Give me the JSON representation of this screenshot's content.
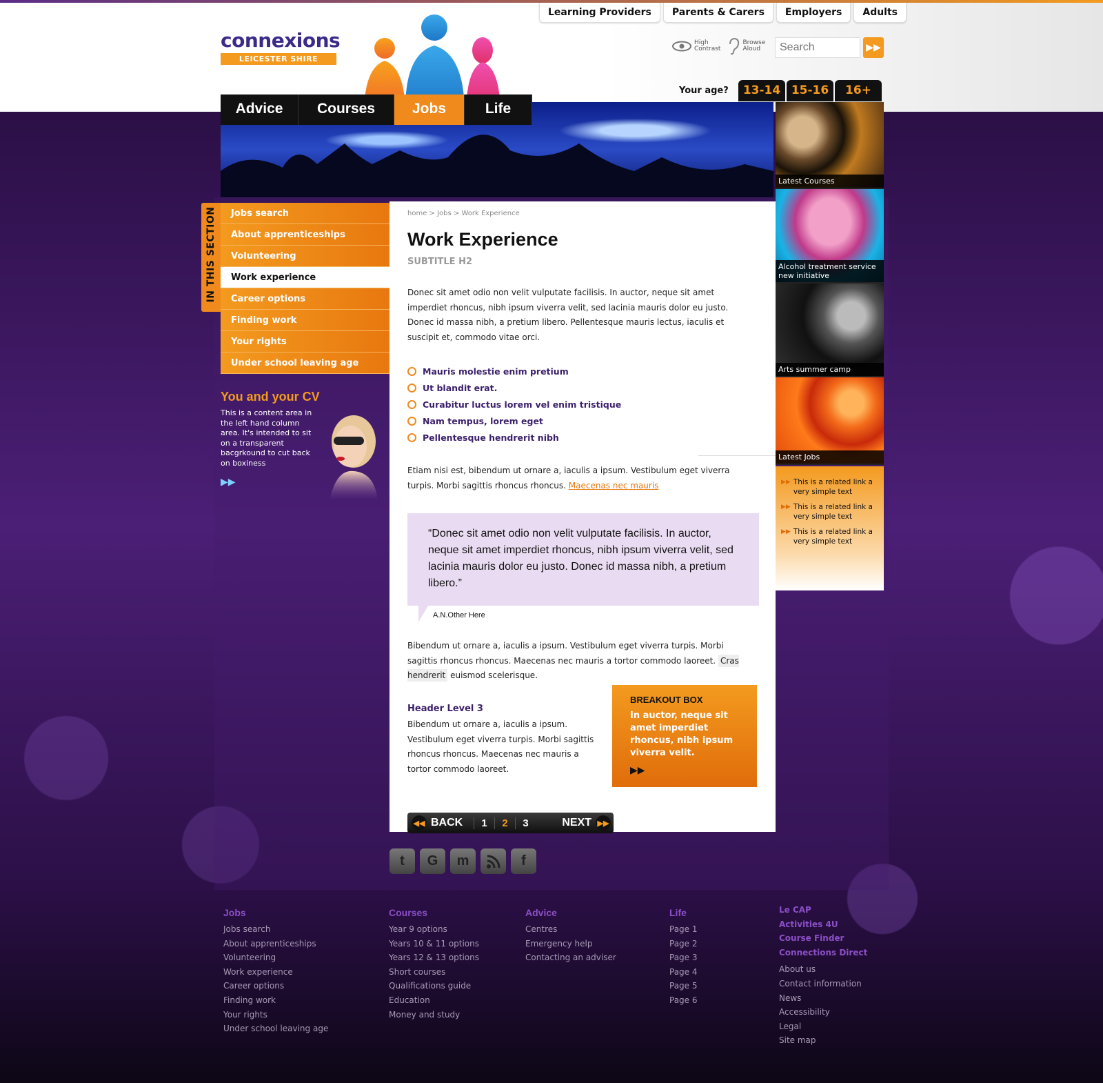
{
  "brand": {
    "logo_text": "connexions",
    "logo_sub": "LEICESTER SHIRE",
    "accent": "#f39a1f",
    "purple": "#3b1f6b"
  },
  "audience_tabs": [
    "Learning Providers",
    "Parents & Carers",
    "Employers",
    "Adults"
  ],
  "tools": {
    "contrast_l1": "High",
    "contrast_l2": "Contrast",
    "aloud_l1": "Browse",
    "aloud_l2": "Aloud"
  },
  "search": {
    "placeholder": "Search",
    "button_icon": "double-arrow-right-icon"
  },
  "age": {
    "label": "Your age?",
    "tabs": [
      "13-14",
      "15-16",
      "16+"
    ]
  },
  "main_nav": [
    "Advice",
    "Courses",
    "Jobs",
    "Life"
  ],
  "main_nav_active": "Jobs",
  "sidebar": {
    "section_label": "IN THIS SECTION",
    "items": [
      "Jobs search",
      "About apprenticeships",
      "Volunteering",
      "Work experience",
      "Career options",
      "Finding work",
      "Your rights",
      "Under school leaving age"
    ],
    "active": "Work experience"
  },
  "cv_promo": {
    "title": "You and your CV",
    "text": "This is a content area in the left hand column area.  It's intended to sit on a transparent bacgrkound to cut back on boxiness",
    "more_icon": "double-arrow-right-icon"
  },
  "content": {
    "breadcrumb": "home > Jobs > Work Experience",
    "title": "Work Experience",
    "subtitle": "SUBTITLE H2",
    "intro": "Donec sit amet odio non velit vulputate facilisis. In auctor, neque sit amet imperdiet rhoncus, nibh ipsum viverra velit, sed lacinia mauris dolor eu justo. Donec id massa nibh, a pretium libero. Pellentesque mauris lectus, iaculis et suscipit et, commodo vitae orci.",
    "bullets": [
      "Mauris molestie enim pretium",
      "Ut blandit erat.",
      "Curabitur luctus lorem vel enim tristique",
      "Nam tempus, lorem eget",
      "Pellentesque hendrerit nibh"
    ],
    "para2": "Etiam nisi est, bibendum ut ornare a, iaculis a ipsum. Vestibulum eget viverra turpis. Morbi sagittis rhoncus rhoncus.",
    "para2_link": "Maecenas nec mauris",
    "quote": "“Donec sit amet odio non velit vulputate facilisis. In auctor, neque sit amet imperdiet rhoncus, nibh ipsum viverra velit, sed lacinia mauris dolor eu justo. Donec id massa nibh, a pretium libero.”",
    "quote_author": "A.N.Other Here",
    "para3": "Bibendum ut ornare a, iaculis a ipsum. Vestibulum eget viverra turpis. Morbi sagittis rhoncus rhoncus. Maecenas nec mauris a tortor commodo laoreet.",
    "para3_highlight": "Cras hendrerit",
    "para3_end": "euismod scelerisque.",
    "h3": "Header Level 3",
    "para4": "Bibendum ut ornare a, iaculis a ipsum. Vestibulum eget viverra turpis. Morbi sagittis rhoncus rhoncus. Maecenas nec mauris a tortor commodo laoreet.",
    "breakout_title": "BREAKOUT BOX",
    "breakout_body": "In auctor, neque sit amet imperdiet rhoncus, nibh ipsum viverra velit."
  },
  "pager": {
    "back": "BACK",
    "pages": [
      "1",
      "2",
      "3"
    ],
    "current": "2",
    "next": "NEXT"
  },
  "promos": [
    {
      "caption": "Latest Courses",
      "color": "#8a5a2a"
    },
    {
      "caption": "Alcohol treatment service new initiative",
      "color": "#2ac7e0"
    },
    {
      "caption": "Arts summer camp",
      "color": "#555555"
    },
    {
      "caption": "Latest Jobs",
      "color": "#f0701a"
    }
  ],
  "related_links": [
    "This is a related link a very simple text",
    "This is a related link a very simple text",
    "This is a related link a very simple text"
  ],
  "social": [
    {
      "icon": "twitter-icon",
      "glyph": "t"
    },
    {
      "icon": "google-icon",
      "glyph": "G"
    },
    {
      "icon": "myspace-icon",
      "glyph": "m"
    },
    {
      "icon": "rss-icon",
      "glyph": "r"
    },
    {
      "icon": "facebook-icon",
      "glyph": "f"
    }
  ],
  "footer": {
    "jobs": {
      "title": "Jobs",
      "links": [
        "Jobs search",
        "About apprenticeships",
        "Volunteering",
        "Work experience",
        "Career options",
        "Finding work",
        "Your rights",
        "Under school leaving age"
      ]
    },
    "courses": {
      "title": "Courses",
      "links": [
        "Year 9 options",
        "Years 10 & 11 options",
        "Years 12 & 13 options",
        "Short courses",
        "Qualifications guide",
        "Education",
        "Money and study"
      ]
    },
    "advice": {
      "title": "Advice",
      "links": [
        "Centres",
        "Emergency help",
        "Contacting an adviser"
      ]
    },
    "life": {
      "title": "Life",
      "links": [
        "Page 1",
        "Page 2",
        "Page 3",
        "Page 4",
        "Page 5",
        "Page 6"
      ]
    },
    "more": {
      "bold_links": [
        "Le CAP",
        "Activities 4U",
        "Course Finder",
        "Connections Direct"
      ],
      "links": [
        "About us",
        "Contact information",
        "News",
        "Accessibility",
        "Legal",
        "Site map"
      ]
    }
  }
}
